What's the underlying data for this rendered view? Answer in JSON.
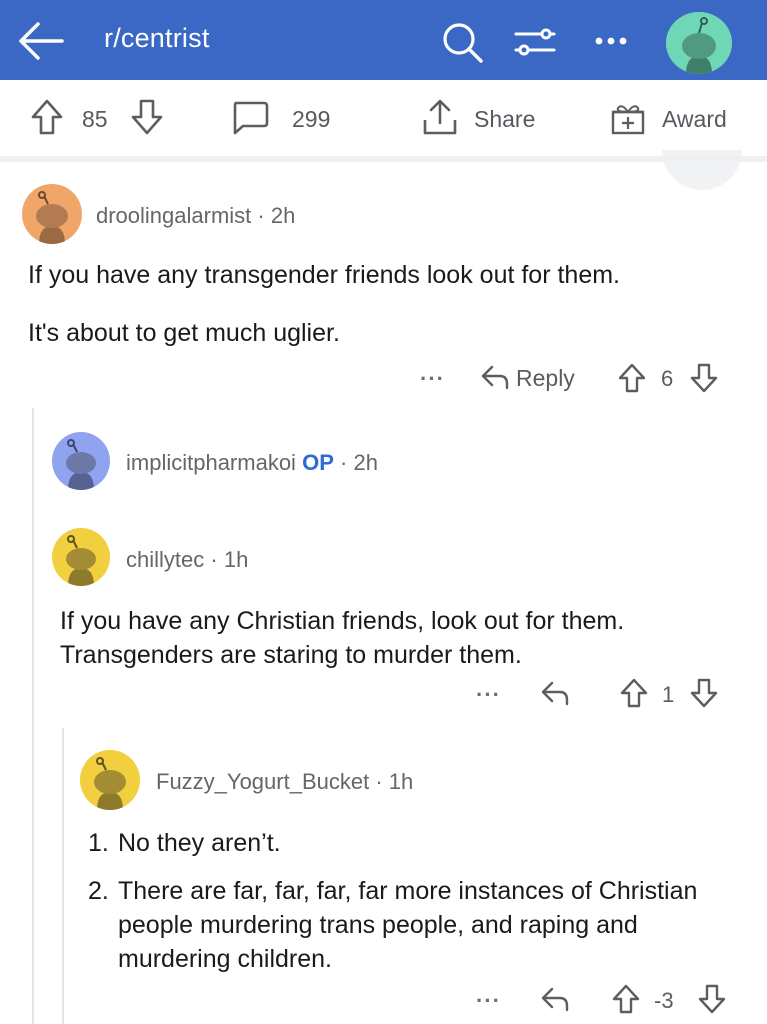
{
  "header": {
    "subreddit": "r/centrist",
    "icons": [
      "back-arrow-icon",
      "search-icon",
      "filter-icon",
      "more-icon",
      "avatar"
    ],
    "bar_color": "#3a68c4"
  },
  "post_actions": {
    "score": "85",
    "comments": "299",
    "share_label": "Share",
    "award_label": "Award"
  },
  "comments": [
    {
      "user": "droolingalarmist",
      "separator": "·",
      "age": "2h",
      "paragraphs": [
        "If you have any transgender friends look out for them.",
        "It's about to get much uglier."
      ],
      "more": "···",
      "reply_label": "Reply",
      "score": "6",
      "avatar_color": "#f0a569"
    },
    {
      "user": "implicitpharmakoi",
      "op_badge": "OP",
      "separator": "·",
      "age": "2h",
      "avatar_color": "#8fa3ee"
    },
    {
      "user": "chillytec",
      "separator": "·",
      "age": "1h",
      "text": "If you have any Christian friends, look out for them. Transgenders are staring to murder them.",
      "more": "···",
      "score": "1",
      "avatar_color": "#f2cf3f"
    },
    {
      "user": "Fuzzy_Yogurt_Bucket",
      "separator": "·",
      "age": "1h",
      "list": [
        {
          "num": "1.",
          "text": "No they aren’t."
        },
        {
          "num": "2.",
          "text": "There are far, far, far, far more instances of Christian people murdering trans people, and raping and murdering children."
        }
      ],
      "more": "···",
      "score": "-3",
      "avatar_color": "#f2cf3f"
    }
  ]
}
